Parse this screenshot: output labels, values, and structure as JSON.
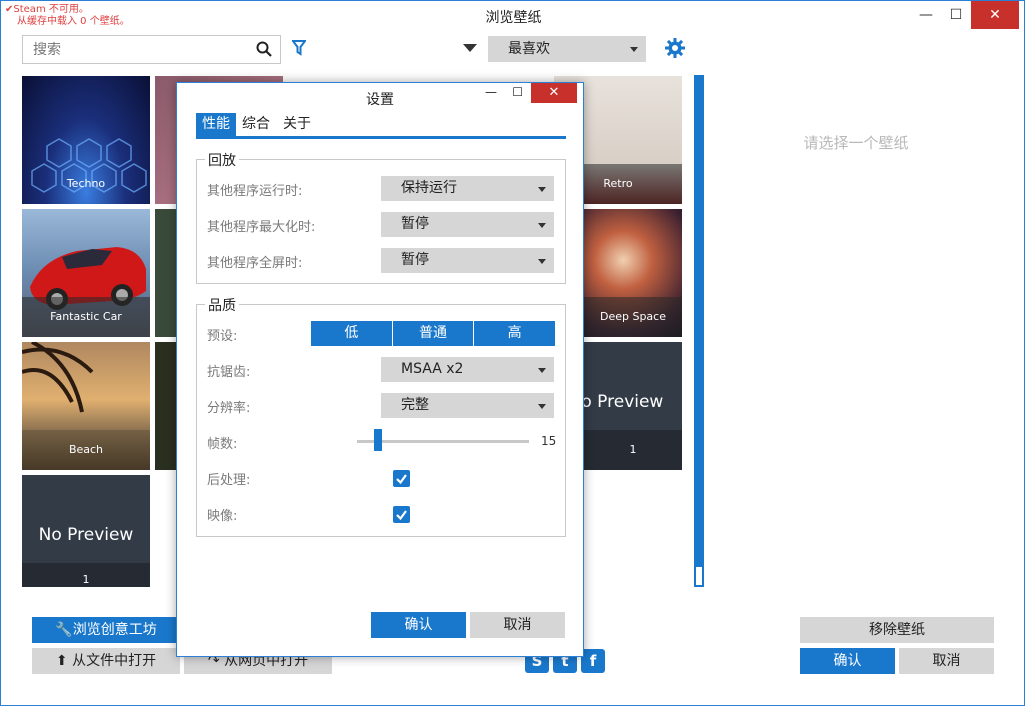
{
  "app": {
    "title": "浏览壁纸",
    "steam_warning_line1": "Steam 不可用。",
    "steam_warning_line2": "从缓存中载入 0 个壁纸。"
  },
  "toolbar": {
    "search_placeholder": "搜索",
    "sort_value": "最喜欢"
  },
  "tiles": [
    {
      "label": "Techno"
    },
    {
      "label": "Retro"
    },
    {
      "label": "Fantastic Car"
    },
    {
      "label": "Deep Space"
    },
    {
      "label": "Beach"
    },
    {
      "label": "No Preview",
      "count": "1"
    },
    {
      "label": "No Preview",
      "count": "1"
    }
  ],
  "side_panel": {
    "empty_text": "请选择一个壁纸",
    "remove_label": "移除壁纸",
    "ok_label": "确认",
    "cancel_label": "取消"
  },
  "bottom_left": {
    "workshop_label": "浏览创意工坊",
    "open_file_label": "从文件中打开",
    "open_web_label": "从网页中打开"
  },
  "dialog": {
    "title": "设置",
    "tabs": [
      "性能",
      "综合",
      "关于"
    ],
    "playback": {
      "title": "回放",
      "rows": [
        {
          "label": "其他程序运行时:",
          "value": "保持运行"
        },
        {
          "label": "其他程序最大化时:",
          "value": "暂停"
        },
        {
          "label": "其他程序全屏时:",
          "value": "暂停"
        }
      ]
    },
    "quality": {
      "title": "品质",
      "preset_label": "预设:",
      "presets": [
        "低",
        "普通",
        "高"
      ],
      "aa_label": "抗锯齿:",
      "aa_value": "MSAA x2",
      "res_label": "分辨率:",
      "res_value": "完整",
      "fps_label": "帧数:",
      "fps_value": "15",
      "fps_level": 0.12,
      "post_label": "后处理:",
      "reflect_label": "映像:"
    },
    "ok_label": "确认",
    "cancel_label": "取消"
  }
}
